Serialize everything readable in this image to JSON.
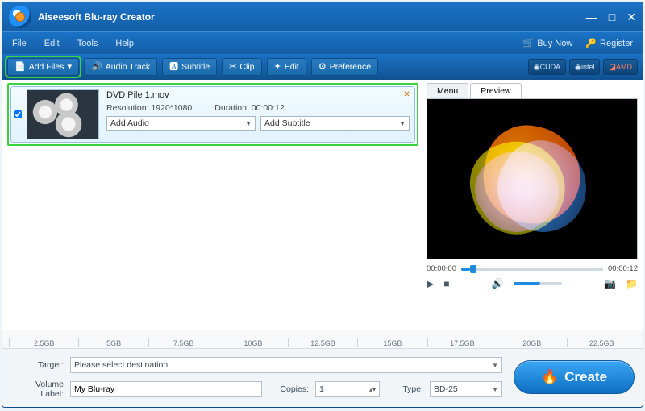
{
  "app": {
    "title": "Aiseesoft Blu-ray Creator"
  },
  "menu": {
    "file": "File",
    "edit": "Edit",
    "tools": "Tools",
    "help": "Help",
    "buynow": "Buy Now",
    "register": "Register"
  },
  "toolbar": {
    "addfiles": "Add Files",
    "audiotrack": "Audio Track",
    "subtitle": "Subtitle",
    "clip": "Clip",
    "edit": "Edit",
    "preference": "Preference",
    "brand_cuda": "CUDA",
    "brand_intel": "intel",
    "brand_amd": "AMD"
  },
  "file": {
    "name": "DVD Pile 1.mov",
    "res_label": "Resolution:",
    "res_value": "1920*1080",
    "dur_label": "Duration:",
    "dur_value": "00:00:12",
    "add_audio": "Add Audio",
    "add_subtitle": "Add Subtitle"
  },
  "preview": {
    "tab_menu": "Menu",
    "tab_preview": "Preview",
    "time_start": "00:00:00",
    "time_end": "00:00:12"
  },
  "ruler": [
    "2.5GB",
    "5GB",
    "7.5GB",
    "10GB",
    "12.5GB",
    "15GB",
    "17.5GB",
    "20GB",
    "22.5GB"
  ],
  "bottom": {
    "target_label": "Target:",
    "target_value": "Please select destination",
    "vol_label": "Volume Label:",
    "vol_value": "My Blu-ray",
    "copies_label": "Copies:",
    "copies_value": "1",
    "type_label": "Type:",
    "type_value": "BD-25",
    "create": "Create"
  }
}
